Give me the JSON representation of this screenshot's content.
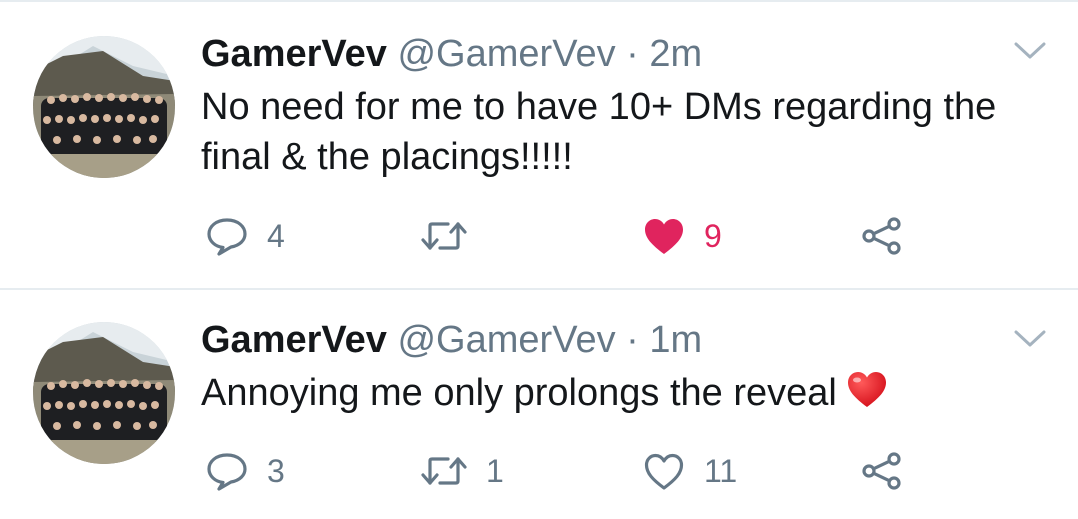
{
  "tweets": [
    {
      "name": "GamerVev",
      "handle": "@GamerVev",
      "separator": "·",
      "time": "2m",
      "text": "No need for me to have 10+ DMs regarding the final & the placings!!!!!",
      "reply_count": "4",
      "retweet_count": "",
      "like_count": "9",
      "liked": true
    },
    {
      "name": "GamerVev",
      "handle": "@GamerVev",
      "separator": "·",
      "time": "1m",
      "text": "Annoying me only prolongs the reveal",
      "reply_count": "3",
      "retweet_count": "1",
      "like_count": "11",
      "liked": false
    }
  ],
  "icons": [
    "chevron-down-icon",
    "reply-icon",
    "retweet-icon",
    "heart-icon",
    "share-icon",
    "red-heart-emoji"
  ],
  "colors": {
    "like_active": "#e0245e",
    "secondary_text": "#657786",
    "divider": "#e6ecf0"
  }
}
